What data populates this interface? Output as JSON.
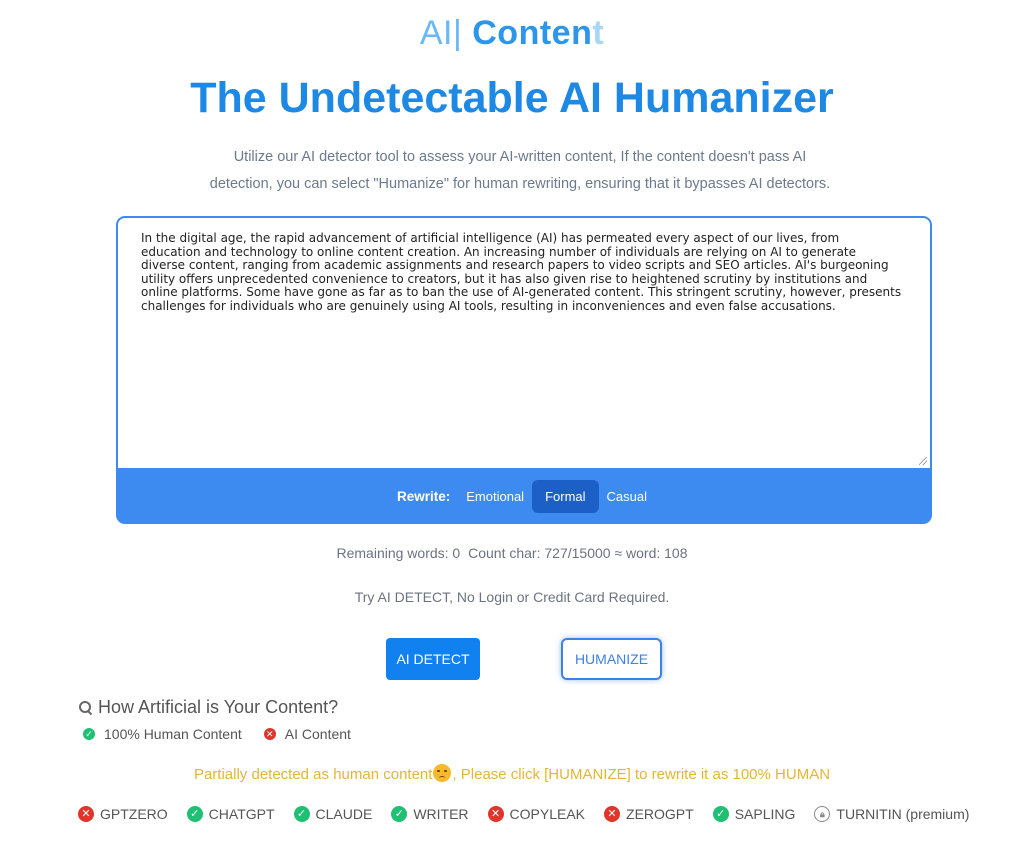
{
  "brand": {
    "part1": "AI|",
    "part2": " Conten",
    "part3": "t"
  },
  "headline": "The Undetectable AI Humanizer",
  "subtitle_line1": "Utilize our AI detector tool to assess your AI-written content, If the content doesn't pass AI",
  "subtitle_line2": "detection, you can select \"Humanize\" for human rewriting, ensuring that it bypasses AI detectors.",
  "editor": {
    "text": "In the digital age, the rapid advancement of artificial intelligence (AI) has permeated every aspect of our lives, from education and technology to online content creation. An increasing number of individuals are relying on AI to generate diverse content, ranging from academic assignments and research papers to video scripts and SEO articles. AI's burgeoning utility offers unprecedented convenience to creators, but it has also given rise to heightened scrutiny by institutions and online platforms. Some have gone as far as to ban the use of AI-generated content. This stringent scrutiny, however, presents challenges for individuals who are genuinely using AI tools, resulting in inconveniences and even false accusations."
  },
  "rewrite": {
    "label": "Rewrite:",
    "options": [
      "Emotional",
      "Formal",
      "Casual"
    ],
    "selected": "Formal"
  },
  "stats": {
    "remaining": "Remaining words: 0",
    "count": "Count char: 727/15000 ≈ word: 108"
  },
  "try_text": "Try AI DETECT, No Login or Credit Card Required.",
  "buttons": {
    "detect": "AI DETECT",
    "humanize": "HUMANIZE"
  },
  "result": {
    "heading": "How Artificial is Your Content?",
    "legend_human": "100% Human Content",
    "legend_ai": "AI Content",
    "partial_before": "Partially detected as human content",
    "partial_after": ", Please click [HUMANIZE] to rewrite it as 100% HUMAN"
  },
  "detectors": [
    {
      "name": "GPTZERO",
      "status": "ai"
    },
    {
      "name": "CHATGPT",
      "status": "human"
    },
    {
      "name": "CLAUDE",
      "status": "human"
    },
    {
      "name": "WRITER",
      "status": "human"
    },
    {
      "name": "COPYLEAK",
      "status": "ai"
    },
    {
      "name": "ZEROGPT",
      "status": "ai"
    },
    {
      "name": "SAPLING",
      "status": "human"
    },
    {
      "name": "TURNITIN (premium)",
      "status": "locked"
    }
  ],
  "colors": {
    "primary": "#1e88e5",
    "bar": "#3d8bf0",
    "human": "#1fbf74",
    "ai": "#e0352b",
    "warning": "#e3b633"
  }
}
